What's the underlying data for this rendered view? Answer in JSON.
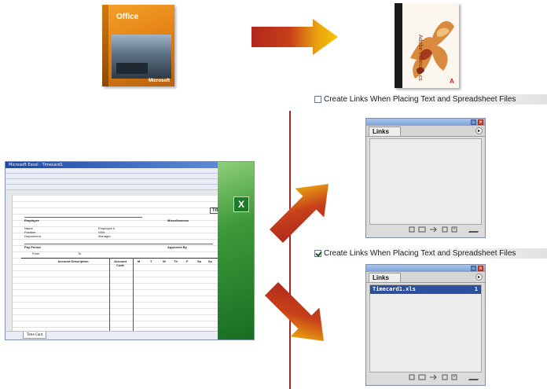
{
  "products": {
    "office": {
      "brand": "Office",
      "maker": "Microsoft"
    },
    "indesign": {
      "name": "Adobe InDesign cs"
    }
  },
  "options": {
    "unchecked_label": "Create Links When Placing Text and Spreadsheet Files",
    "checked_label": "Create Links When Placing Text and Spreadsheet Files",
    "unchecked_state": false,
    "checked_state": true
  },
  "palettes": {
    "empty": {
      "tab": "Links",
      "menu_glyph": "▸"
    },
    "linked": {
      "tab": "Links",
      "menu_glyph": "▸",
      "items": [
        {
          "file": "Timecard1.xls",
          "page": "1"
        }
      ]
    }
  },
  "excel": {
    "title_bar": "Microsoft Excel - Timecard1",
    "sheet_header": "Title",
    "sections": [
      "Employee",
      "Miscellaneous",
      "Pay Period",
      "Approved By"
    ],
    "fields": [
      "Name",
      "Position",
      "Department",
      "Employee #",
      "SSN",
      "Manager",
      "From",
      "To"
    ],
    "table_columns": [
      "Account Description",
      "Account Code",
      "M",
      "T",
      "W",
      "Th",
      "F",
      "Sa",
      "Su"
    ],
    "sheet_tab": "Time Card"
  },
  "colors": {
    "arrow_red": "#a8241e",
    "arrow_yellow": "#f2c200",
    "divider": "#a8241e",
    "selection": "#2c4f9e",
    "excel_green": "#1d7a2b"
  }
}
